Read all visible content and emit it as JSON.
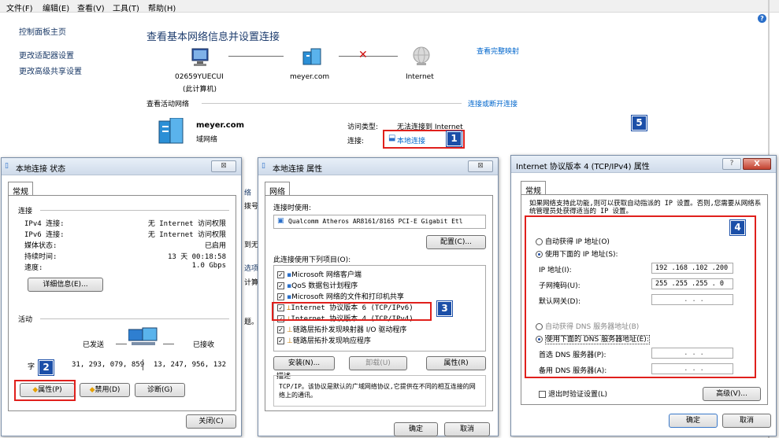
{
  "menu": [
    "文件(F)",
    "编辑(E)",
    "查看(V)",
    "工具(T)",
    "帮助(H)"
  ],
  "sidebar": {
    "home": "控制面板主页",
    "adapter": "更改适配器设置",
    "sharing": "更改高级共享设置"
  },
  "main": {
    "title": "查看基本网络信息并设置连接",
    "full_map": "查看完整映射",
    "computer_name": "02659YUECUI",
    "computer_sub": "(此计算机)",
    "domain": "meyer.com",
    "internet": "Internet",
    "active_networks": "查看活动网络",
    "connect_disconnect": "连接或断开连接",
    "network_name": "meyer.com",
    "network_type": "域网络",
    "access_type_label": "访问类型:",
    "access_type_value": "无法连接到 Internet",
    "connection_label": "连接:",
    "connection_value": "本地连接",
    "partial_texts": [
      "络",
      "拨号",
      "到无",
      "选项",
      "计算",
      "题。"
    ]
  },
  "status_dialog": {
    "title": "本地连接 状态",
    "close_glyph": "⊠",
    "tab": "常规",
    "section_connection": "连接",
    "rows": [
      {
        "label": "IPv4 连接:",
        "value": "无 Internet 访问权限"
      },
      {
        "label": "IPv6 连接:",
        "value": "无 Internet 访问权限"
      },
      {
        "label": "媒体状态:",
        "value": "已启用"
      },
      {
        "label": "持续时间:",
        "value": "13 天 00:18:58"
      },
      {
        "label": "速度:",
        "value": "1.0 Gbps"
      }
    ],
    "details_button": "详细信息(E)...",
    "section_activity": "活动",
    "sent": "已发送",
    "received": "已接收",
    "bytes_label": "字",
    "bytes_sent": "31, 293, 079, 859",
    "bytes_received": "13, 247, 956, 132",
    "properties_button": "属性(P)",
    "disable_button": "禁用(D)",
    "diagnose_button": "诊断(G)",
    "close_button": "关闭(C)"
  },
  "props_dialog": {
    "title": "本地连接 属性",
    "close_glyph": "⊠",
    "tab": "网络",
    "connect_using": "连接时使用:",
    "adapter": "Qualcomm Atheros AR8161/8165 PCI-E Gigabit Etl",
    "configure_button": "配置(C)...",
    "items_label": "此连接使用下列项目(O):",
    "items": [
      "Microsoft 网络客户端",
      "QoS 数据包计划程序",
      "Microsoft 网络的文件和打印机共享",
      "Internet 协议版本 6 (TCP/IPv6)",
      "Internet 协议版本 4 (TCP/IPv4)",
      "链路层拓扑发现映射器 I/O 驱动程序",
      "链路层拓扑发现响应程序"
    ],
    "install_button": "安装(N)...",
    "uninstall_button": "卸载(U)",
    "properties_button": "属性(R)",
    "description_label": "描述",
    "description": "TCP/IP。该协议是默认的广域网络协议,它提供在不同的相互连接的网络上的通讯。",
    "ok_button": "确定",
    "cancel_button": "取消"
  },
  "ipv4_dialog": {
    "title": "Internet 协议版本 4 (TCP/IPv4) 属性",
    "question_glyph": "?",
    "close_glyph": "X",
    "tab": "常规",
    "intro": "如果网络支持此功能,则可以获取自动指派的 IP 设置。否则,您需要从网络系统管理员处获得适当的 IP 设置。",
    "auto_ip": "自动获得 IP 地址(O)",
    "manual_ip": "使用下面的 IP 地址(S):",
    "ip_label": "IP 地址(I):",
    "ip_value": "192 .168 .102 .200",
    "mask_label": "子网掩码(U):",
    "mask_value": "255 .255 .255 . 0",
    "gateway_label": "默认网关(D):",
    "gateway_value": ".   .   .",
    "auto_dns": "自动获得 DNS 服务器地址(B)",
    "manual_dns": "使用下面的 DNS 服务器地址(E):",
    "dns1_label": "首选 DNS 服务器(P):",
    "dns1_value": ".   .   .",
    "dns2_label": "备用 DNS 服务器(A):",
    "dns2_value": ".   .   .",
    "validate": "退出时验证设置(L)",
    "advanced_button": "高级(V)...",
    "ok_button": "确定",
    "cancel_button": "取消"
  },
  "badges": [
    "1",
    "2",
    "3",
    "4",
    "5"
  ],
  "colors": {
    "highlight": "#e0201c",
    "badge": "#1b4fa8",
    "link": "#0066cc"
  }
}
